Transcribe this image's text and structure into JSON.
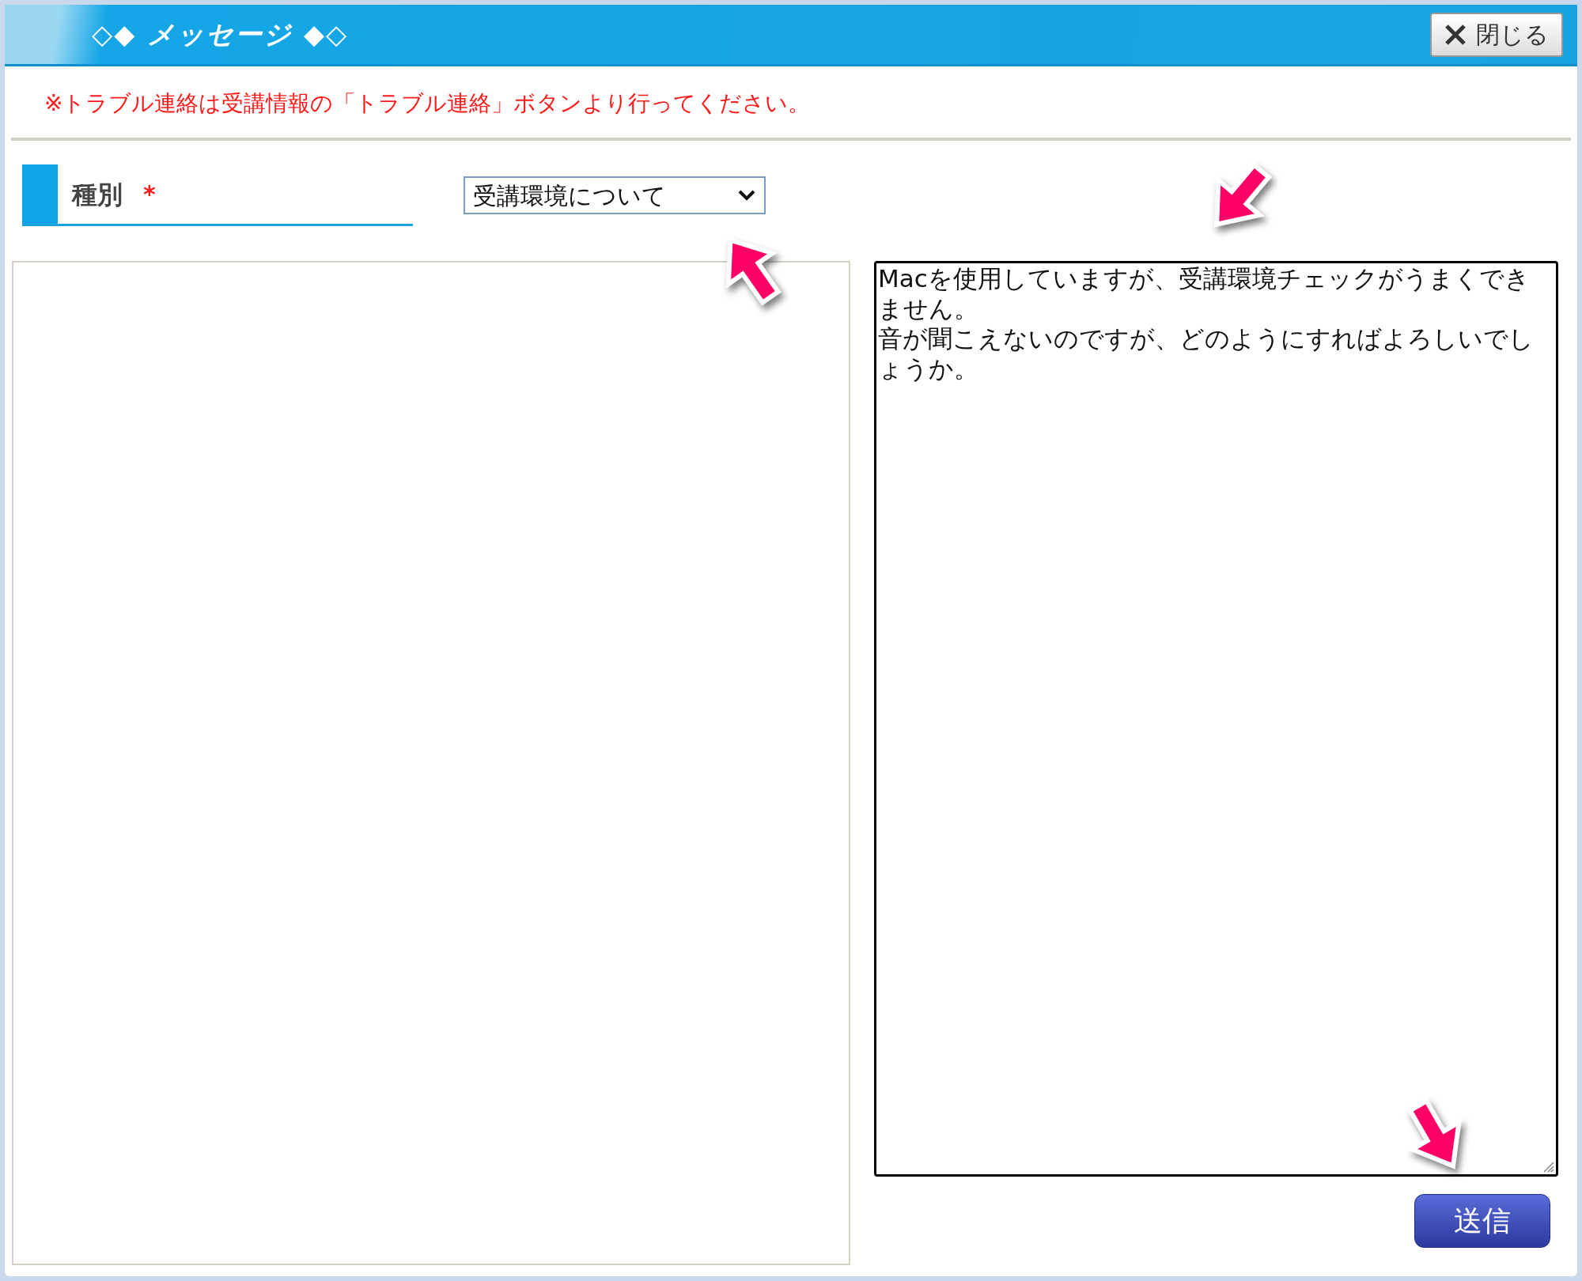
{
  "window": {
    "title": "◇◆ メッセージ ◆◇",
    "close_button": "閉じる"
  },
  "notice": "※トラブル連絡は受講情報の「トラブル連絡」ボタンより行ってください。",
  "form": {
    "category": {
      "label": "種別",
      "required_mark": "*",
      "value": "受講環境について"
    },
    "message": [
      "Macを使用していますが、受講環境チェックがうまくできません。",
      "音が聞こえないのですが、どのようにすればよろしいでしょうか。"
    ],
    "submit_button": "送信"
  }
}
